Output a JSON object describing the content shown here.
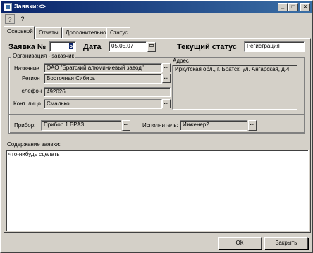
{
  "window": {
    "title": "Заявки:<>"
  },
  "toolbar": {
    "help_icon": "?",
    "whatis_icon": "?"
  },
  "tabs": [
    {
      "label": "Основной"
    },
    {
      "label": "Отчеты"
    },
    {
      "label": "Дополнительно"
    },
    {
      "label": "Статус"
    }
  ],
  "header": {
    "order_label": "Заявка №",
    "order_number": "5",
    "date_label": "Дата",
    "date_value": "05.05.07",
    "status_label": "Текущий статус",
    "status_value": "Регистрация"
  },
  "customer": {
    "group_title": "Организация - заказчик",
    "name_label": "Название",
    "name_value": "ОАО \"Братский алюминиевый завод\"",
    "region_label": "Регион",
    "region_value": "Восточная Сибирь",
    "phone_label": "Телефон",
    "phone_value": "492026",
    "contact_label": "Конт. лицо",
    "contact_value": "Смалько",
    "address_label": "Адрес",
    "address_value": "Иркутская обл., г. Братск, ул. Ангарская, д.4"
  },
  "device": {
    "device_label": "Прибор:",
    "device_value": "Прибор 1 БРАЗ",
    "executor_label": "Исполнитель:",
    "executor_value": "Инженер2"
  },
  "content": {
    "label": "Содержание заявки:",
    "value": "что-нибудь сделать"
  },
  "buttons": {
    "ok": "ОК",
    "close": "Закрыть"
  }
}
